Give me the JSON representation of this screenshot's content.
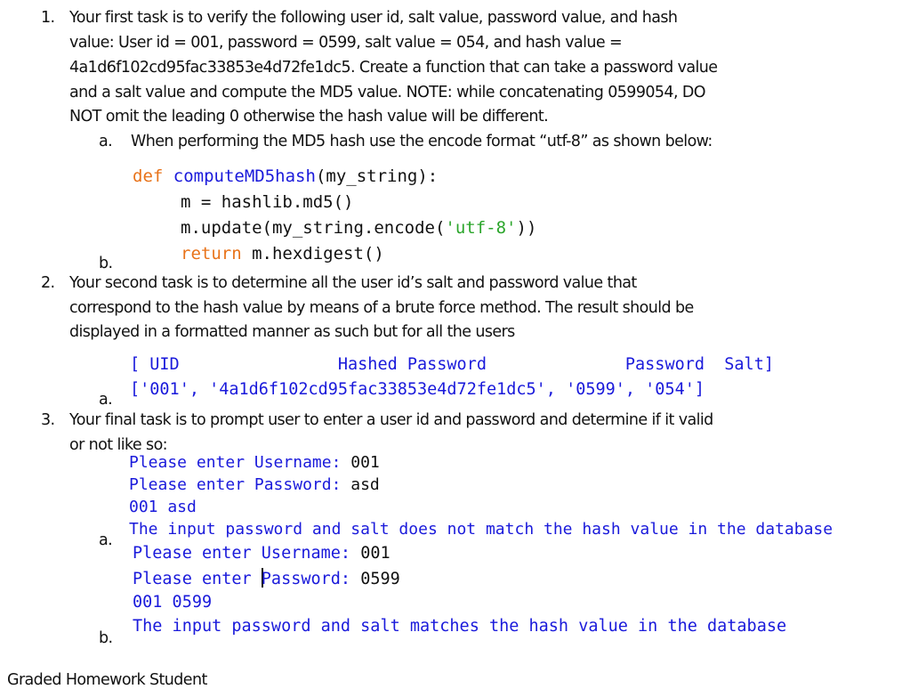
{
  "task1": {
    "number": "1.",
    "lines": [
      "Your first task is to verify the following user id, salt value, password value, and hash",
      "value: User id = 001, password = 0599, salt value = 054, and hash value =",
      "4a1d6f102cd95fac33853e4d72fe1dc5. Create a function that can take a password value",
      "and a salt value and compute the MD5 value. NOTE: while concatenating 0599054, DO",
      "NOT omit the leading 0 otherwise the hash value will be different."
    ],
    "sub_a": {
      "label": "a.",
      "text": "When performing the MD5 hash use the encode format “utf-8” as shown below:"
    },
    "code": {
      "def_kw": "def",
      "func_name": "computeMD5hash",
      "func_sig": "(my_string):",
      "line2": "m = hashlib.md5()",
      "line3_pre": "m.update(my_string.encode(",
      "line3_str": "'utf-8'",
      "line3_post": "))",
      "return_kw": "return",
      "return_rest": " m.hexdigest()"
    },
    "sub_b": {
      "label": "b."
    }
  },
  "task2": {
    "number": "2.",
    "lines": [
      "Your second task is to determine all the user id’s salt and password value that",
      "correspond to the hash value by means of a brute force method. The result should be",
      "displayed in a formatted manner as such but for all the users"
    ],
    "sub_a": {
      "label": "a.",
      "header": "[ UID                Hashed Password              Password  Salt]",
      "row": "['001', '4a1d6f102cd95fac33853e4d72fe1dc5', '0599', '054']"
    }
  },
  "task3": {
    "number": "3.",
    "lines": [
      "Your final task is to prompt user to enter a user id and password and determine if it valid",
      "or not like so:"
    ],
    "sub_a": {
      "label": "a.",
      "username_prompt": "Please enter Username: ",
      "username_value": "001",
      "password_prompt": "Please enter Password: ",
      "password_value": "asd",
      "echo": "001 asd",
      "result": "The input password and salt does not match the hash value in the database"
    },
    "sub_b": {
      "label": "b.",
      "username_prompt": "Please enter Username: ",
      "username_value": "001",
      "password_prompt_a": "Please enter ",
      "password_prompt_b": "Password: ",
      "password_value": "0599",
      "echo": "001 0599",
      "result": "The input password and salt matches the hash value in the database"
    }
  },
  "footer": {
    "partial_text": "Graded Homework Student"
  }
}
